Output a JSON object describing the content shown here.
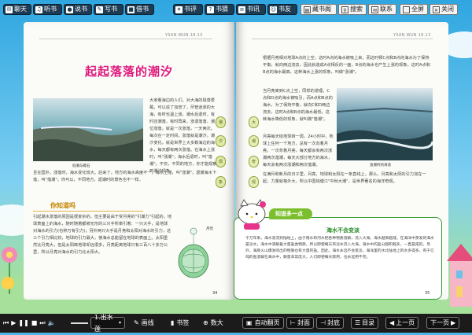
{
  "toolbar_left": [
    {
      "label": "聊天",
      "icon": "chat-icon"
    },
    {
      "label": "听书",
      "icon": "headphones-icon"
    },
    {
      "label": "说书",
      "icon": "mic-icon"
    },
    {
      "label": "写书",
      "icon": "pen-icon"
    },
    {
      "label": "借书",
      "icon": "book-icon"
    },
    {
      "label": "书评",
      "icon": "comment-icon"
    },
    {
      "label": "书猜",
      "icon": "question-icon"
    },
    {
      "label": "书讯",
      "icon": "news-icon"
    },
    {
      "label": "书友",
      "icon": "friends-icon"
    }
  ],
  "toolbar_right": [
    {
      "label": "藏书阁",
      "icon": "library-icon"
    },
    {
      "label": "搜索",
      "icon": "search-icon"
    },
    {
      "label": "联系",
      "icon": "mail-icon"
    },
    {
      "label": "全屏",
      "icon": "fullscreen-icon"
    },
    {
      "label": "关闭",
      "icon": "close-icon"
    }
  ],
  "left_page": {
    "header": "YSAN WUN 18.13",
    "title": "起起落落的潮汐",
    "intro": "大家看海边的人们，对大海的极感爱戴。可以说了加倍了，尽管迷涨的大海，有时也温上涨，潮水后退时，有时还潮落，有时再来，涨退落落，潮位涨落，就是一次涨落，一天两次。每次在一定时间，涨落就是潮汐。潮汐变化，就是世界上大多数海边的海水，每天都有两次涨落。在海水上涨时，叫\"涨潮\"；海水后退时，叫\"落潮\"。不仅，不同的地方，你才能观察到潮汐现象。",
    "photo_caption": "低潮与礁石",
    "intro2": "且在国外，涨落时，海水变化较大。后来了，地方的海水高度不一，海水上涨，叫\"涨潮\"；退潮海水下落，叫\"落潮\"。你可以，不同地方，退潮时的景色也不一样。",
    "section_title": "你知道吗",
    "body": "引起潮水涨落的原因是很复杂的，但主要是由于受月亮的\"引潮力\"引起的。地球表面上的海水，随时随着都被无形的三只手所牵引着：一只大手，是地球对海水的引力(也称万有引力)；另外两只大手是月亮和太阳对海水的引力，这三个引力相比较，地球的引力最大，使海水总能留在地球的表面上。太阳虽然比月亮大，但是太阳离地球却远很多，月亮距离地球只有三百八十多万公里，所以月亮对海水的引力比太阳大。",
    "diagram_label": "月亮",
    "page_number": "34"
  },
  "right_page": {
    "header": "YSAN WUN 18.13",
    "p1": "根据月亮相对地球A点的上空，这时A点的海水被吸上来，而这时候C点和B点的海水为了保持平衡，就向两边流去，因此就造成A点相反的一面，B点的海水也产生上涨的现象。这时A点和B点的海水最高，这种海水上涨的现象，叫做\"涨潮\"。",
    "p2": "当月亮离到C点上空，同样的道理，C点和D点的海水被吸引，而A点和B点的海水，为了保持平衡，就向C和D两边流去，这时A点和B点的海水最低，这种海水降低的现象，就叫做\"落潮\"。",
    "p3": "月亮每天绕地球转一周，24小时中，地球上任何一个地方，总有一次向着月亮，一次背着月亮，每天都会有两次涨潮两次落潮，每天大部分地方的海水，每天会有两次涨潮和两次落潮。",
    "p4": "在满月和新月的日子里，月亮、地球和太阳在一条直线上，那么，月亮和太阳的引力加在一起，力量就格外大，所以中国钱塘江\"中秋大潮\"，是世界著名的海洋奇观。",
    "photo_caption": "涨潮时的海浪",
    "know_banner": "知道多一点",
    "know_title": "海水不会变淡",
    "know_text": "千万年来，海水浪流到陆地上，由于雨水和河水把各种物质溶解，流入大海，海水越来越咸。在海洋中蒸发的海水是淡水，海水中溶解着大量盐类物质，所以即使每天有淡水流入大海，海水中的盐分越积越多，一直是咸的。另外，海底火山爆发喷出的物质也有大量的盐。因此，海水永远不会变淡，海洋里的水比陆地上的水多得多，有千亿吨的盐溶解在海水中，数量非常庞大，人们即使每天取用，也永远用不完。",
    "page_number": "35"
  },
  "side_tabs_left": [
    "潮",
    "汐",
    "现",
    "象"
  ],
  "side_tabs_right": [
    "大",
    "潮",
    "奇",
    "观"
  ],
  "bottom": {
    "track": "1.出水莲",
    "buttons": [
      "画线",
      "书签",
      "数大",
      "自动翻页",
      "封面",
      "封底",
      "目录",
      "上一页",
      "下一页"
    ],
    "icons": {
      "draw": "pencil-icon",
      "bookmark": "bookmark-icon",
      "zoom": "zoom-icon"
    }
  }
}
